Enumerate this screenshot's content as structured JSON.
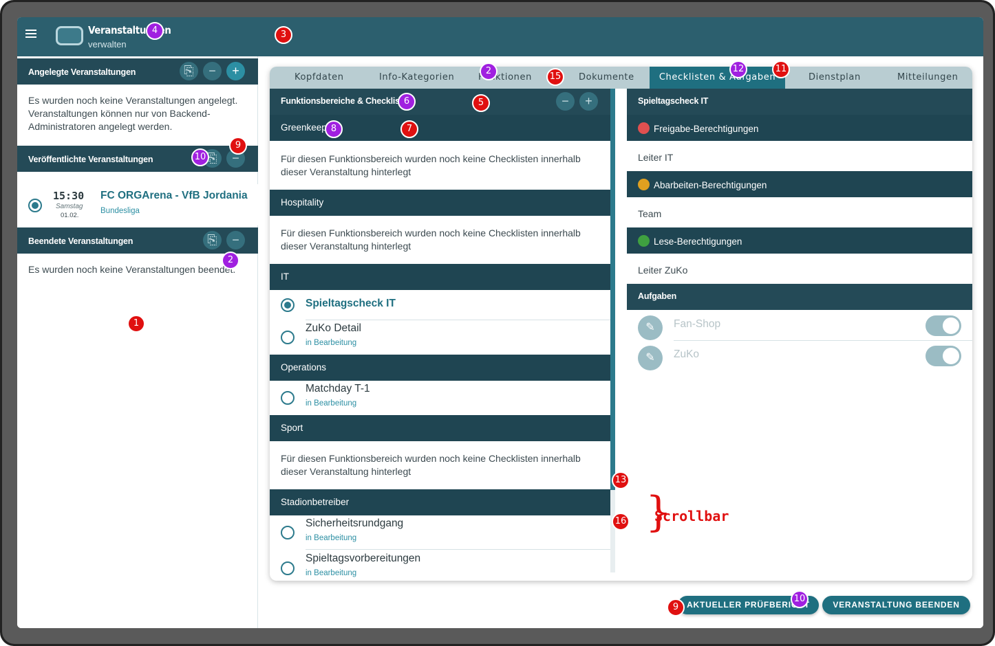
{
  "app": {
    "title": "Veranstaltungen",
    "subtitle": "verwalten"
  },
  "sidebar": {
    "created": {
      "header": "Angelegte Veranstaltungen",
      "empty_text": "Es wurden noch keine Veranstaltungen angelegt. Veranstaltungen können nur von Backend-Administratoren angelegt werden."
    },
    "published": {
      "header": "Veröffentlichte Veranstaltungen",
      "event": {
        "time": "15:30",
        "day": "Samstag",
        "date": "01.02.",
        "name": "FC ORGArena - VfB Jordania",
        "league": "Bundesliga"
      }
    },
    "finished": {
      "header": "Beendete Veranstaltungen",
      "empty_text": "Es wurden noch keine Veranstaltungen beendet."
    }
  },
  "tabs": [
    "Kopfdaten",
    "Info-Kategorien",
    "Funktionen",
    "Dokumente",
    "Checklisten & Aufgaben",
    "Dienstplan",
    "Mitteilungen"
  ],
  "active_tab": "Checklisten & Aufgaben",
  "left_panel": {
    "header": "Funktionsbereiche & Checklisten",
    "empty_note": "Für diesen Funktionsbereich wurden noch keine Checklisten innerhalb dieser Veranstaltung hinterlegt",
    "sections": {
      "greenkeeping": "Greenkeeping",
      "hospitality": "Hospitality",
      "it": "IT",
      "operations": "Operations",
      "sport": "Sport",
      "stadion": "Stadionbetreiber"
    },
    "items": {
      "spieltagscheck": {
        "title": "Spieltagscheck IT"
      },
      "zuko": {
        "title": "ZuKo Detail",
        "status": "in Bearbeitung"
      },
      "matchday": {
        "title": "Matchday T-1",
        "status": "in Bearbeitung"
      },
      "sicherheit": {
        "title": "Sicherheitsrundgang",
        "status": "in Bearbeitung"
      },
      "vorbereitung": {
        "title": "Spieltagsvorbereitungen",
        "status": "in Bearbeitung"
      }
    }
  },
  "right_panel": {
    "header": "Spieltagscheck IT",
    "release": {
      "label": "Freigabe-Berechtigungen",
      "value": "Leiter IT",
      "color": "#e05050"
    },
    "process": {
      "label": "Abarbeiten-Berechtigungen",
      "value": "Team",
      "color": "#e0a020"
    },
    "read": {
      "label": "Lese-Berechtigungen",
      "value": "Leiter ZuKo",
      "color": "#3fa040"
    },
    "tasks_header": "Aufgaben",
    "tasks": [
      {
        "label": "Fan-Shop",
        "enabled": true
      },
      {
        "label": "ZuKo",
        "enabled": true
      }
    ]
  },
  "buttons": {
    "report": "AKTUELLER PRÜFBERICHT",
    "finish": "VERANSTALTUNG BEENDEN"
  },
  "annotations": {
    "scrollbar_label": "Scrollbar",
    "m1": "1",
    "m2": "2",
    "m3": "3",
    "m4": "4",
    "m5": "5",
    "m6": "6",
    "m7": "7",
    "m8": "8",
    "m9": "9",
    "m10": "10",
    "m11": "11",
    "m12": "12",
    "m13": "13",
    "m15": "15",
    "m16": "16"
  }
}
